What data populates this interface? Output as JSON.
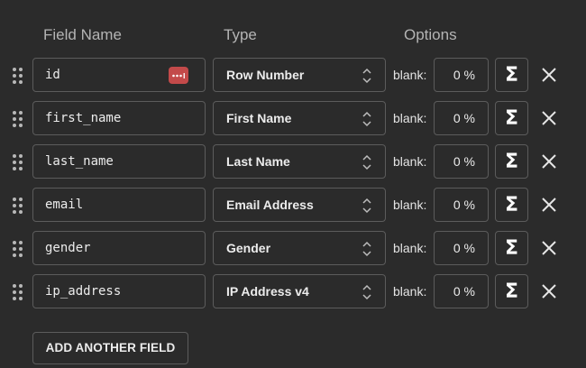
{
  "headers": {
    "field_name": "Field Name",
    "type": "Type",
    "options": "Options"
  },
  "rows": [
    {
      "field": "id",
      "type": "Row Number",
      "blank_label": "blank:",
      "blank_value": "0 %",
      "has_badge": true
    },
    {
      "field": "first_name",
      "type": "First Name",
      "blank_label": "blank:",
      "blank_value": "0 %"
    },
    {
      "field": "last_name",
      "type": "Last Name",
      "blank_label": "blank:",
      "blank_value": "0 %"
    },
    {
      "field": "email",
      "type": "Email Address",
      "blank_label": "blank:",
      "blank_value": "0 %"
    },
    {
      "field": "gender",
      "type": "Gender",
      "blank_label": "blank:",
      "blank_value": "0 %"
    },
    {
      "field": "ip_address",
      "type": "IP Address v4",
      "blank_label": "blank:",
      "blank_value": "0 %"
    }
  ],
  "sigma_symbol": "Σ",
  "add_button_label": "ADD ANOTHER FIELD",
  "icons": {
    "drag": "drag-handle-icon",
    "badge": "password-manager-icon",
    "select": "chevron-updown-icon",
    "formula": "sigma-icon",
    "remove": "close-icon"
  },
  "colors": {
    "background": "#2b2b2b",
    "border": "#5c5c5c",
    "badge": "#c34a4a",
    "header_text": "#b4b4b4"
  }
}
